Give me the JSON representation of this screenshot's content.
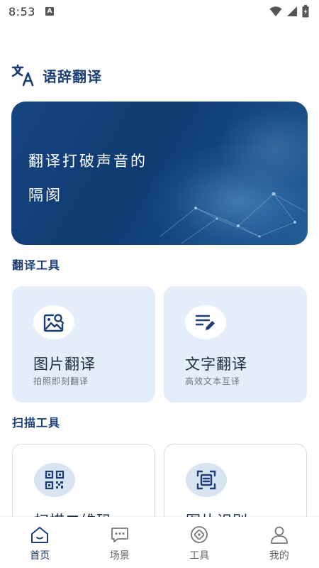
{
  "status_bar": {
    "time": "8:53",
    "notification_badge": "A"
  },
  "header": {
    "title": "语辞翻译",
    "logo_icon": "translate-icon"
  },
  "banner": {
    "line1": "翻译打破声音的",
    "line2": "隔阂"
  },
  "sections": {
    "translate_tools": "翻译工具",
    "scan_tools": "扫描工具"
  },
  "translate_cards": [
    {
      "title": "图片翻译",
      "subtitle": "拍照即刻翻译",
      "icon": "image-search-icon"
    },
    {
      "title": "文字翻译",
      "subtitle": "高效文本互译",
      "icon": "text-edit-icon"
    }
  ],
  "scan_cards": [
    {
      "title": "扫描二维码",
      "icon": "qr-code-icon"
    },
    {
      "title": "图片识别",
      "icon": "document-scan-icon"
    }
  ],
  "bottom_nav": [
    {
      "label": "首页",
      "icon": "home-icon",
      "active": true
    },
    {
      "label": "场景",
      "icon": "chat-icon",
      "active": false
    },
    {
      "label": "工具",
      "icon": "tool-icon",
      "active": false
    },
    {
      "label": "我的",
      "icon": "profile-icon",
      "active": false
    }
  ],
  "colors": {
    "brand": "#1b3f74",
    "card_bg": "#e4eefb"
  }
}
